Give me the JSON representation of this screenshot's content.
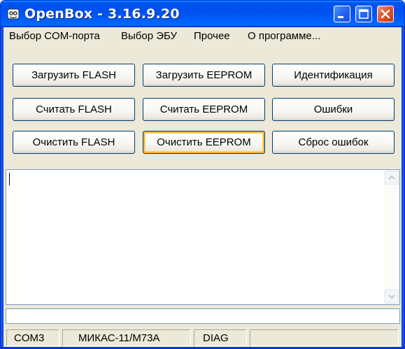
{
  "window": {
    "title": "OpenBox - 3.16.9.20",
    "icon": "openbox-app-icon",
    "controls": {
      "minimize": "minimize-icon",
      "maximize": "maximize-icon",
      "close": "close-icon"
    }
  },
  "menu": {
    "items": [
      {
        "label": "Выбор COM-порта"
      },
      {
        "label": "Выбор ЭБУ"
      },
      {
        "label": "Прочее"
      },
      {
        "label": "О программе..."
      }
    ]
  },
  "buttons": {
    "load_flash": "Загрузить FLASH",
    "load_eeprom": "Загрузить EEPROM",
    "identification": "Идентификация",
    "read_flash": "Считать FLASH",
    "read_eeprom": "Считать EEPROM",
    "errors": "Ошибки",
    "clear_flash": "Очистить FLASH",
    "clear_eeprom": "Очистить EEPROM",
    "reset_errors": "Сброс ошибок"
  },
  "log": {
    "text": ""
  },
  "command": {
    "value": ""
  },
  "status": {
    "port": "COM3",
    "ecu": "МИКАС-11/М73А",
    "mode": "DIAG"
  },
  "colors": {
    "titlebar": "#0053ee",
    "window_bg": "#ece9d8",
    "focus_ring": "#f8b636",
    "close_button": "#e4552b"
  }
}
